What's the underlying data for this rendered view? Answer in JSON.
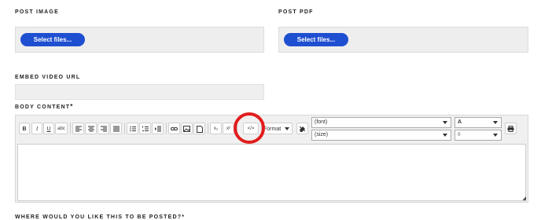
{
  "post_image": {
    "label": "POST IMAGE",
    "button": "Select files..."
  },
  "post_pdf": {
    "label": "POST PDF",
    "button": "Select files..."
  },
  "embed_video": {
    "label": "EMBED VIDEO URL",
    "value": ""
  },
  "body_content": {
    "label": "BODY CONTENT",
    "required_mark": "*"
  },
  "toolbar": {
    "bold": "B",
    "italic": "I",
    "underline": "U",
    "strike": "abc",
    "subscript": "x₂",
    "superscript": "x²",
    "source": "</>",
    "format": "Format",
    "font": "(font)",
    "size": "(size)",
    "font_color": "A",
    "bg_color": "◊"
  },
  "next_question": {
    "label": "WHERE WOULD YOU LIKE THIS TO BE POSTED?",
    "required_mark": "*"
  },
  "colors": {
    "accent": "#1f4fd1",
    "highlight_circle": "#e21d1d"
  },
  "icons": [
    "align-left-icon",
    "align-center-icon",
    "align-right-icon",
    "align-justify-icon",
    "bullet-list-icon",
    "numbered-list-icon",
    "indent-icon",
    "link-icon",
    "image-icon",
    "document-icon",
    "print-icon",
    "eraser-icon",
    "resize-handle-icon"
  ]
}
